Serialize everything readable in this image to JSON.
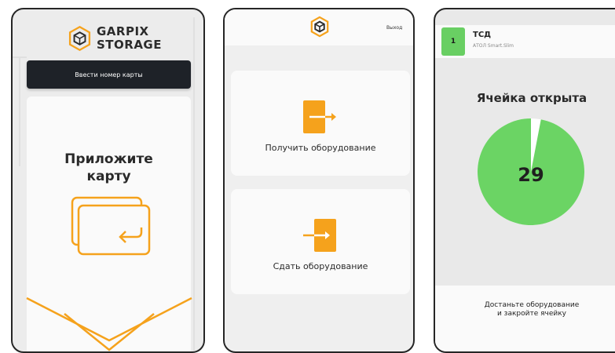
{
  "screen1": {
    "brand_line1": "GARPIX",
    "brand_line2": "STORAGE",
    "enter_card_button": "Ввести номер карты",
    "prompt_line1": "Приложите",
    "prompt_line2": "карту",
    "accent": "#f5a21c"
  },
  "screen2": {
    "exit_label": "Выход",
    "get_equipment_label": "Получить оборудование",
    "return_equipment_label": "Сдать оборудование",
    "accent": "#f5a21c"
  },
  "screen3": {
    "cell_number": "1",
    "device_name": "ТСД",
    "device_model": "АТОЛ Smart.Slim",
    "status_title": "Ячейка открыта",
    "countdown": "29",
    "countdown_fraction": 0.97,
    "hint_line1": "Достаньте оборудование",
    "hint_line2": "и закройте ячейку",
    "accent": "#6bd464"
  }
}
